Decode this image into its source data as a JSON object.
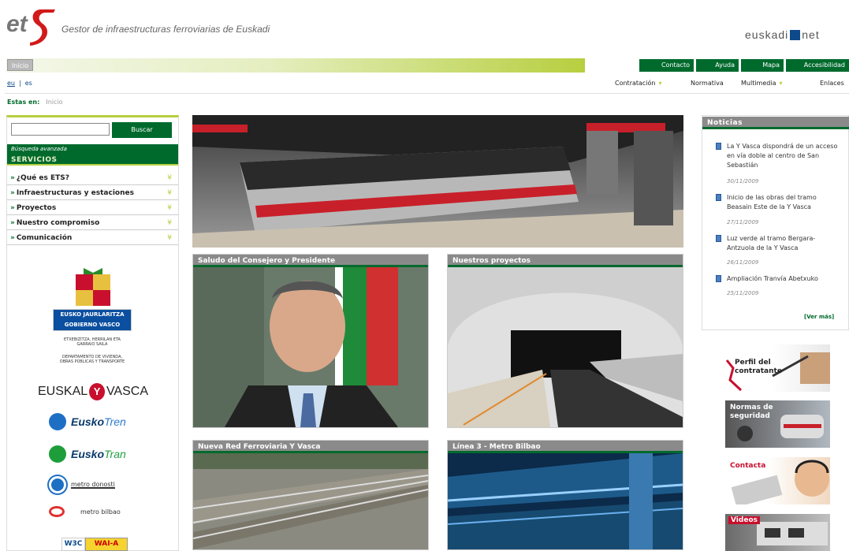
{
  "header": {
    "logo_text": "ets",
    "tagline": "Gestor de infraestructuras ferroviarias de Euskadi",
    "euskadinet_left": "euskadi",
    "euskadinet_right": "net"
  },
  "topbar": {
    "inicio": "Inicio",
    "buttons": [
      "Contacto",
      "Ayuda",
      "Mapa",
      "Accesibilidad"
    ]
  },
  "langs": [
    "eu",
    "|",
    "es"
  ],
  "nav": {
    "items": [
      "Contratación",
      "Normativa",
      "Multimedia",
      "Enlaces"
    ]
  },
  "breadcrumb": {
    "label": "Estas en:",
    "current": "Inicio"
  },
  "search": {
    "value": "",
    "button": "Buscar",
    "advanced": "Búsqueda avanzada"
  },
  "servicios": {
    "title": "SERVICIOS",
    "items": [
      "¿Qué es ETS?",
      "Infraestructuras y estaciones",
      "Proyectos",
      "Nuestro compromiso",
      "Comunicación"
    ]
  },
  "logos": {
    "gv_line1": "EUSKO JAURLARITZA",
    "gv_line2": "GOBIERNO VASCO",
    "gv_dept_eu_1": "ETXEBIZITZA, HERRILAN ETA",
    "gv_dept_eu_2": "GARRAIO SAILA",
    "gv_dept_es_1": "DEPARTAMENTO DE VIVIENDA,",
    "gv_dept_es_2": "OBRAS PÚBLICAS Y TRANSPORTE",
    "ey_left": "EUSKAL",
    "ey_mid": "Y",
    "ey_right": "VASCA",
    "eusko": "Eusko",
    "tren": "Tren",
    "tran": "Tran",
    "metro_donosti": "metro donosti",
    "metro_bilbao": "metro bilbao",
    "w3c": "W3C",
    "wai": "WAI-A"
  },
  "panels": [
    {
      "title": "Saludo del Consejero y Presidente"
    },
    {
      "title": "Nuestros proyectos"
    },
    {
      "title": "Nueva Red Ferroviaria Y Vasca"
    },
    {
      "title": "Línea 3 - Metro Bilbao"
    }
  ],
  "news": {
    "title": "Noticias",
    "items": [
      {
        "text": "La Y Vasca dispondrá de un acceso en vía doble al centro de San Sebastián",
        "date": "30/11/2009"
      },
      {
        "text": "Inicio de las obras del tramo Beasain Este de la Y Vasca",
        "date": "27/11/2009"
      },
      {
        "text": "Luz verde al tramo Bergara-Antzuola de la Y Vasca",
        "date": "26/11/2009"
      },
      {
        "text": "Ampliación Tranvía Abetxuko",
        "date": "25/11/2009"
      }
    ],
    "more": "[Ver más]"
  },
  "banners": {
    "perfil": "Perfil del contratante",
    "normas": "Normas de seguridad",
    "contacta": "Contacta",
    "videos": "Videos"
  },
  "colors": {
    "primary_green": "#006a2d",
    "lime": "#b7cf3f",
    "panel_gray": "#8a8a8a"
  }
}
